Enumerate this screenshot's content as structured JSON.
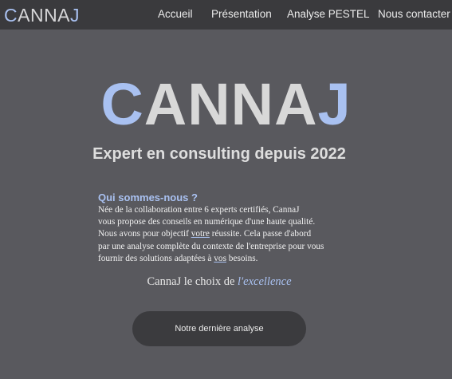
{
  "navbar": {
    "brand_first_letter": "C",
    "brand_rest": "ANNA",
    "brand_last_letter": "J",
    "links": [
      "Accueil",
      "Présentation",
      "Analyse PESTEL",
      "Nous contacter"
    ]
  },
  "hero": {
    "title_first_letter": "C",
    "title_rest": "ANNA",
    "title_last_letter": "J",
    "subtitle": "Expert en consulting depuis 2022"
  },
  "about": {
    "heading": "Qui sommes-nous ?",
    "line1": "Née de la collaboration entre 6 experts certifiés, CannaJ",
    "line2": "vous propose des conseils en numérique d'une haute qualité.",
    "line3_before": "Nous avons pour objectif ",
    "line3_em": "votre",
    "line3_after": " réussite. Cela passe d'abord",
    "line4": "par une analyse complète du contexte de l'entreprise pour vous",
    "line5_before": "fournir des solutions adaptées à ",
    "line5_em": "vos",
    "line5_after": " besoins."
  },
  "tagline": {
    "text": "CannaJ le choix de ",
    "emphasis": "l'excellence"
  },
  "cta": {
    "label": "Notre dernière analyse"
  },
  "colors": {
    "accent": "#a9c1f1",
    "background": "#59595e",
    "navbar": "#3a3a3d",
    "button": "#3b3b3e"
  }
}
